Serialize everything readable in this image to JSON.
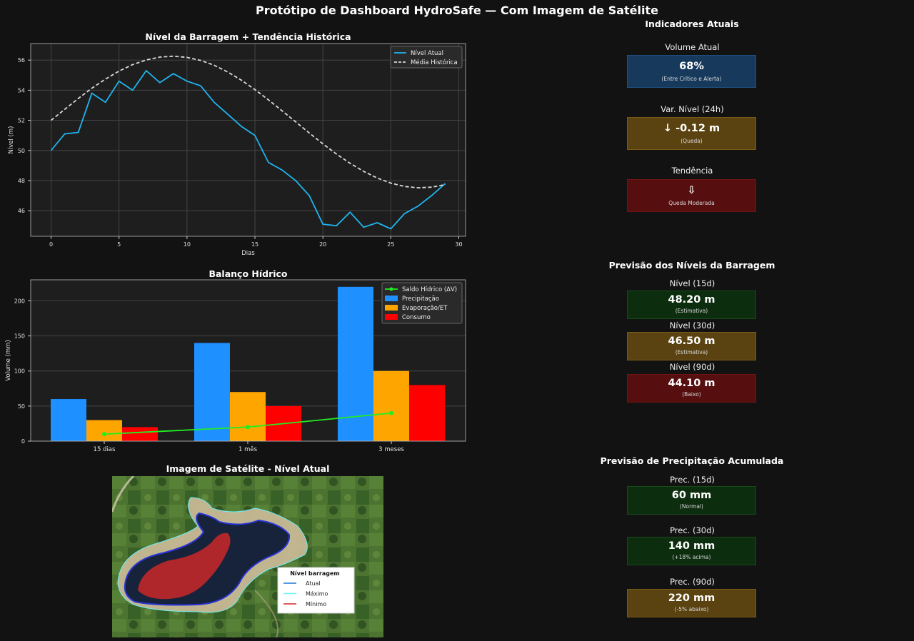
{
  "page_title": "Protótipo de Dashboard HydroSafe — Com Imagem de Satélite",
  "chart_data": [
    {
      "type": "line",
      "title": "Nível da Barragem + Tendência Histórica",
      "xlabel": "Dias",
      "ylabel": "Nível (m)",
      "xlim": [
        -1.5,
        30.5
      ],
      "ylim": [
        44.3,
        57.1
      ],
      "xticks": [
        0,
        5,
        10,
        15,
        20,
        25,
        30
      ],
      "yticks": [
        46,
        48,
        50,
        52,
        54,
        56
      ],
      "grid": true,
      "legend_position": "top-right",
      "x": [
        0,
        1,
        2,
        3,
        4,
        5,
        6,
        7,
        8,
        9,
        10,
        11,
        12,
        13,
        14,
        15,
        16,
        17,
        18,
        19,
        20,
        21,
        22,
        23,
        24,
        25,
        26,
        27,
        28,
        29
      ],
      "series": [
        {
          "name": "Nível Atual",
          "style": "solid",
          "color": "#1fb4ee",
          "values": [
            50.0,
            51.1,
            51.2,
            53.8,
            53.2,
            54.6,
            54.0,
            55.3,
            54.5,
            55.1,
            54.6,
            54.3,
            53.2,
            52.4,
            51.6,
            51.0,
            49.2,
            48.7,
            48.0,
            47.0,
            45.1,
            45.0,
            45.9,
            44.9,
            45.2,
            44.8,
            45.8,
            46.3,
            47.0,
            47.8
          ]
        },
        {
          "name": "Média Histórica",
          "style": "dashed",
          "color": "#d9d9d9",
          "values": [
            52.0,
            52.73,
            53.45,
            54.13,
            54.74,
            55.27,
            55.7,
            56.01,
            56.2,
            56.26,
            56.18,
            55.98,
            55.66,
            55.21,
            54.67,
            54.04,
            53.36,
            52.63,
            51.9,
            51.16,
            50.44,
            49.76,
            49.15,
            48.61,
            48.17,
            47.83,
            47.61,
            47.52,
            47.56,
            47.73
          ]
        }
      ]
    },
    {
      "type": "bar",
      "title": "Balanço Hídrico",
      "xlabel": "",
      "ylabel": "Volume (mm)",
      "ylim": [
        0,
        230
      ],
      "yticks": [
        0,
        50,
        100,
        150,
        200
      ],
      "grid": true,
      "legend_position": "top-right",
      "categories": [
        "15 dias",
        "1 mês",
        "3 meses"
      ],
      "series": [
        {
          "name": "Precipitação",
          "color": "#1e90ff",
          "values": [
            60,
            140,
            220
          ]
        },
        {
          "name": "Evaporação/ET",
          "color": "#ffa500",
          "values": [
            30,
            70,
            100
          ]
        },
        {
          "name": "Consumo",
          "color": "#ff0000",
          "values": [
            20,
            50,
            80
          ]
        }
      ],
      "line_series": {
        "name": "Saldo Hídrico (ΔV)",
        "color": "#22ee22",
        "values": [
          10,
          20,
          40
        ]
      }
    }
  ],
  "satellite": {
    "title": "Imagem de Satélite - Nível Atual",
    "legend": {
      "title": "Nível barragem",
      "items": [
        {
          "label": "Atual",
          "color": "#1f77d4"
        },
        {
          "label": "Máximo",
          "color": "#6ff3ff"
        },
        {
          "label": "Mínimo",
          "color": "#d62728"
        }
      ]
    }
  },
  "indicators": {
    "title": "Indicadores Atuais",
    "cards": [
      {
        "label": "Volume Atual",
        "value": "68%",
        "sub": "(Entre Crítico e Alerta)",
        "color": "blue"
      },
      {
        "label": "Var. Nível (24h)",
        "value": "↓ -0.12 m",
        "sub": "(Queda)",
        "color": "amber"
      },
      {
        "label": "Tendência",
        "value": "⇩",
        "sub": "Queda Moderada",
        "color": "red"
      }
    ]
  },
  "level_forecast": {
    "title": "Previsão dos Níveis da Barragem",
    "cards": [
      {
        "label": "Nível (15d)",
        "value": "48.20 m",
        "sub": "(Estimativa)",
        "color": "green"
      },
      {
        "label": "Nível (30d)",
        "value": "46.50 m",
        "sub": "(Estimativa)",
        "color": "amber"
      },
      {
        "label": "Nível (90d)",
        "value": "44.10 m",
        "sub": "(Baixo)",
        "color": "red"
      }
    ]
  },
  "precip_forecast": {
    "title": "Previsão de Precipitação Acumulada",
    "cards": [
      {
        "label": "Prec. (15d)",
        "value": "60 mm",
        "sub": "(Normal)",
        "color": "green"
      },
      {
        "label": "Prec. (30d)",
        "value": "140 mm",
        "sub": "(+18% acima)",
        "color": "green"
      },
      {
        "label": "Prec. (90d)",
        "value": "220 mm",
        "sub": "(-5% abaixo)",
        "color": "amber"
      }
    ]
  }
}
